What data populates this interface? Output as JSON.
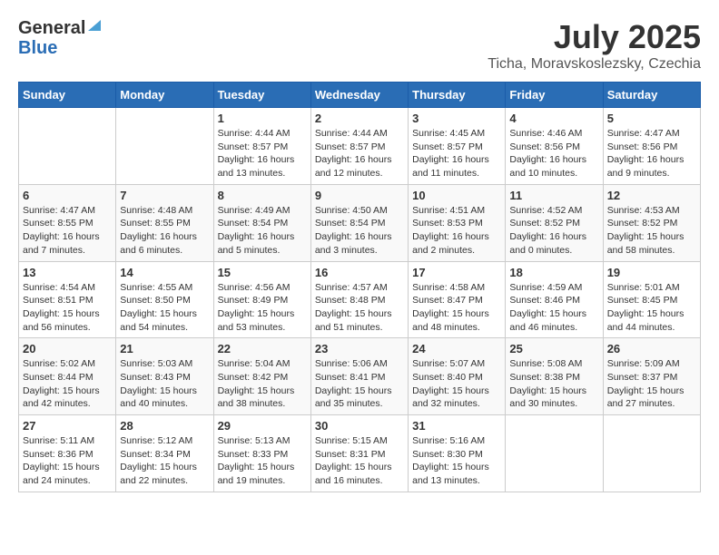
{
  "header": {
    "logo_general": "General",
    "logo_blue": "Blue",
    "month": "July 2025",
    "location": "Ticha, Moravskoslezsky, Czechia"
  },
  "weekdays": [
    "Sunday",
    "Monday",
    "Tuesday",
    "Wednesday",
    "Thursday",
    "Friday",
    "Saturday"
  ],
  "weeks": [
    [
      {
        "day": "",
        "info": ""
      },
      {
        "day": "",
        "info": ""
      },
      {
        "day": "1",
        "info": "Sunrise: 4:44 AM\nSunset: 8:57 PM\nDaylight: 16 hours and 13 minutes."
      },
      {
        "day": "2",
        "info": "Sunrise: 4:44 AM\nSunset: 8:57 PM\nDaylight: 16 hours and 12 minutes."
      },
      {
        "day": "3",
        "info": "Sunrise: 4:45 AM\nSunset: 8:57 PM\nDaylight: 16 hours and 11 minutes."
      },
      {
        "day": "4",
        "info": "Sunrise: 4:46 AM\nSunset: 8:56 PM\nDaylight: 16 hours and 10 minutes."
      },
      {
        "day": "5",
        "info": "Sunrise: 4:47 AM\nSunset: 8:56 PM\nDaylight: 16 hours and 9 minutes."
      }
    ],
    [
      {
        "day": "6",
        "info": "Sunrise: 4:47 AM\nSunset: 8:55 PM\nDaylight: 16 hours and 7 minutes."
      },
      {
        "day": "7",
        "info": "Sunrise: 4:48 AM\nSunset: 8:55 PM\nDaylight: 16 hours and 6 minutes."
      },
      {
        "day": "8",
        "info": "Sunrise: 4:49 AM\nSunset: 8:54 PM\nDaylight: 16 hours and 5 minutes."
      },
      {
        "day": "9",
        "info": "Sunrise: 4:50 AM\nSunset: 8:54 PM\nDaylight: 16 hours and 3 minutes."
      },
      {
        "day": "10",
        "info": "Sunrise: 4:51 AM\nSunset: 8:53 PM\nDaylight: 16 hours and 2 minutes."
      },
      {
        "day": "11",
        "info": "Sunrise: 4:52 AM\nSunset: 8:52 PM\nDaylight: 16 hours and 0 minutes."
      },
      {
        "day": "12",
        "info": "Sunrise: 4:53 AM\nSunset: 8:52 PM\nDaylight: 15 hours and 58 minutes."
      }
    ],
    [
      {
        "day": "13",
        "info": "Sunrise: 4:54 AM\nSunset: 8:51 PM\nDaylight: 15 hours and 56 minutes."
      },
      {
        "day": "14",
        "info": "Sunrise: 4:55 AM\nSunset: 8:50 PM\nDaylight: 15 hours and 54 minutes."
      },
      {
        "day": "15",
        "info": "Sunrise: 4:56 AM\nSunset: 8:49 PM\nDaylight: 15 hours and 53 minutes."
      },
      {
        "day": "16",
        "info": "Sunrise: 4:57 AM\nSunset: 8:48 PM\nDaylight: 15 hours and 51 minutes."
      },
      {
        "day": "17",
        "info": "Sunrise: 4:58 AM\nSunset: 8:47 PM\nDaylight: 15 hours and 48 minutes."
      },
      {
        "day": "18",
        "info": "Sunrise: 4:59 AM\nSunset: 8:46 PM\nDaylight: 15 hours and 46 minutes."
      },
      {
        "day": "19",
        "info": "Sunrise: 5:01 AM\nSunset: 8:45 PM\nDaylight: 15 hours and 44 minutes."
      }
    ],
    [
      {
        "day": "20",
        "info": "Sunrise: 5:02 AM\nSunset: 8:44 PM\nDaylight: 15 hours and 42 minutes."
      },
      {
        "day": "21",
        "info": "Sunrise: 5:03 AM\nSunset: 8:43 PM\nDaylight: 15 hours and 40 minutes."
      },
      {
        "day": "22",
        "info": "Sunrise: 5:04 AM\nSunset: 8:42 PM\nDaylight: 15 hours and 38 minutes."
      },
      {
        "day": "23",
        "info": "Sunrise: 5:06 AM\nSunset: 8:41 PM\nDaylight: 15 hours and 35 minutes."
      },
      {
        "day": "24",
        "info": "Sunrise: 5:07 AM\nSunset: 8:40 PM\nDaylight: 15 hours and 32 minutes."
      },
      {
        "day": "25",
        "info": "Sunrise: 5:08 AM\nSunset: 8:38 PM\nDaylight: 15 hours and 30 minutes."
      },
      {
        "day": "26",
        "info": "Sunrise: 5:09 AM\nSunset: 8:37 PM\nDaylight: 15 hours and 27 minutes."
      }
    ],
    [
      {
        "day": "27",
        "info": "Sunrise: 5:11 AM\nSunset: 8:36 PM\nDaylight: 15 hours and 24 minutes."
      },
      {
        "day": "28",
        "info": "Sunrise: 5:12 AM\nSunset: 8:34 PM\nDaylight: 15 hours and 22 minutes."
      },
      {
        "day": "29",
        "info": "Sunrise: 5:13 AM\nSunset: 8:33 PM\nDaylight: 15 hours and 19 minutes."
      },
      {
        "day": "30",
        "info": "Sunrise: 5:15 AM\nSunset: 8:31 PM\nDaylight: 15 hours and 16 minutes."
      },
      {
        "day": "31",
        "info": "Sunrise: 5:16 AM\nSunset: 8:30 PM\nDaylight: 15 hours and 13 minutes."
      },
      {
        "day": "",
        "info": ""
      },
      {
        "day": "",
        "info": ""
      }
    ]
  ]
}
